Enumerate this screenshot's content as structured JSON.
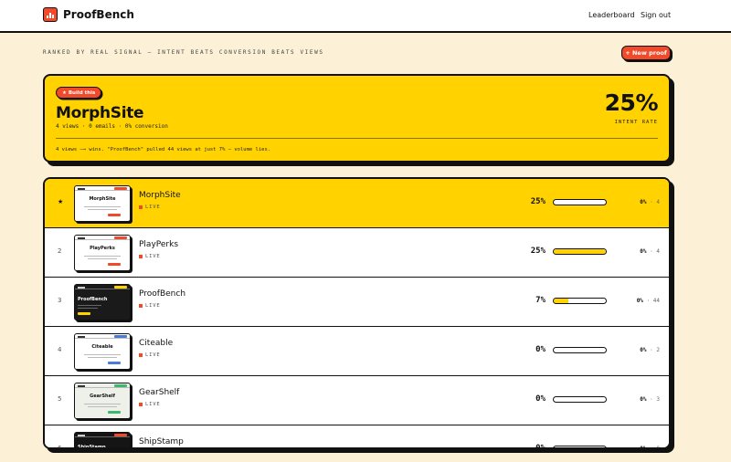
{
  "app": {
    "name": "ProofBench"
  },
  "nav": {
    "leaderboard": "Leaderboard",
    "signout": "Sign out"
  },
  "tagline": "RANKED BY REAL SIGNAL — INTENT BEATS CONVERSION BEATS VIEWS",
  "new_proof_label": "+ New proof",
  "hero": {
    "badge": "★ Build this",
    "title": "MorphSite",
    "stats": "4 views · 0 emails · 0% conversion",
    "rate": "25%",
    "rate_label": "INTENT RATE",
    "note": "4 views —→ wins. \"ProofBench\" pulled 44 views at just 7% — volume lies."
  },
  "rows": [
    {
      "rank": "★",
      "name": "MorphSite",
      "status": "LIVE",
      "rate": "25%",
      "fill": 0,
      "conv": "0%",
      "views": "4",
      "highlight": true,
      "thumb": {
        "bg": "#ffffff",
        "title": "MorphSite",
        "accent": "#f04a2a",
        "text": "#111111",
        "dark": false
      }
    },
    {
      "rank": "2",
      "name": "PlayPerks",
      "status": "LIVE",
      "rate": "25%",
      "fill": 1,
      "conv": "0%",
      "views": "4",
      "highlight": false,
      "thumb": {
        "bg": "#ffffff",
        "title": "PlayPerks",
        "accent": "#f04a2a",
        "text": "#111111",
        "dark": false
      }
    },
    {
      "rank": "3",
      "name": "ProofBench",
      "status": "LIVE",
      "rate": "7%",
      "fill": 0.28,
      "conv": "0%",
      "views": "44",
      "highlight": false,
      "thumb": {
        "bg": "#1a1a1a",
        "title": "ProofBench",
        "accent": "#ffd200",
        "text": "#ffffff",
        "dark": true
      }
    },
    {
      "rank": "4",
      "name": "Citeable",
      "status": "LIVE",
      "rate": "0%",
      "fill": 0,
      "conv": "0%",
      "views": "2",
      "highlight": false,
      "thumb": {
        "bg": "#ffffff",
        "title": "Citeable",
        "accent": "#4a7bd8",
        "text": "#111111",
        "dark": false
      }
    },
    {
      "rank": "5",
      "name": "GearShelf",
      "status": "LIVE",
      "rate": "0%",
      "fill": 0,
      "conv": "0%",
      "views": "3",
      "highlight": false,
      "thumb": {
        "bg": "#eef1ea",
        "title": "GearShelf",
        "accent": "#3cb86a",
        "text": "#111111",
        "dark": false
      }
    },
    {
      "rank": "6",
      "name": "ShipStamp",
      "status": "LIVE",
      "rate": "0%",
      "fill": 0,
      "conv": "0%",
      "views": "0",
      "highlight": false,
      "thumb": {
        "bg": "#151515",
        "title": "ShipStamp",
        "accent": "#f04a2a",
        "text": "#ffffff",
        "dark": true
      }
    }
  ],
  "colors": {
    "accent": "#f04a2a",
    "yellow": "#ffd200",
    "cream": "#fcf1d6",
    "ink": "#111111"
  }
}
